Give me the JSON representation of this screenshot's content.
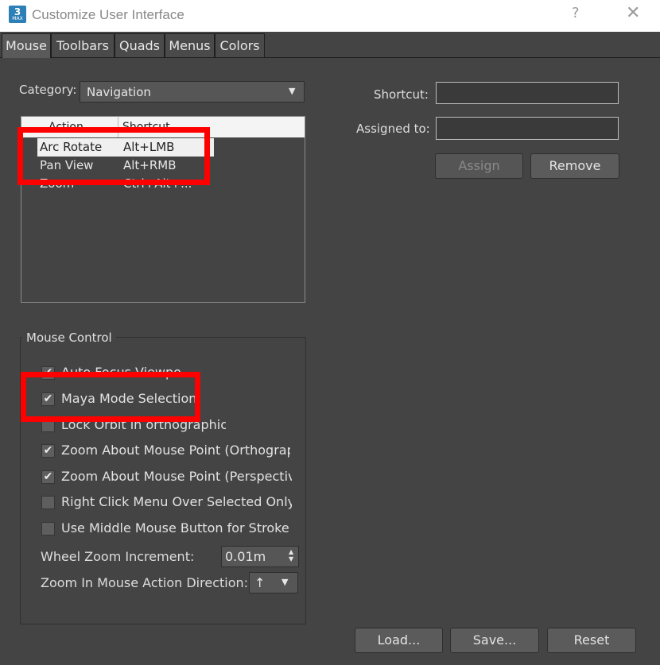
{
  "window": {
    "title": "Customize User Interface",
    "icon_number": "3",
    "icon_sub": "MAX",
    "help_glyph": "?",
    "close_glyph": "✕"
  },
  "tabs": [
    {
      "label": "Mouse",
      "active": true
    },
    {
      "label": "Toolbars",
      "active": false
    },
    {
      "label": "Quads",
      "active": false
    },
    {
      "label": "Menus",
      "active": false
    },
    {
      "label": "Colors",
      "active": false
    }
  ],
  "category": {
    "label": "Category:",
    "value": "Navigation"
  },
  "action_list": {
    "headers": [
      "Action",
      "Shortcut"
    ],
    "rows": [
      {
        "action": "Arc Rotate",
        "shortcut": "Alt+LMB",
        "selected": true
      },
      {
        "action": "Pan View",
        "shortcut": "Alt+RMB",
        "selected": false
      },
      {
        "action": "Zoom",
        "shortcut": "Ctrl+Alt+..."
      }
    ]
  },
  "shortcut": {
    "label": "Shortcut:",
    "value": ""
  },
  "assigned_to": {
    "label": "Assigned to:",
    "value": ""
  },
  "buttons": {
    "assign": "Assign",
    "remove": "Remove",
    "load": "Load...",
    "save": "Save...",
    "reset": "Reset"
  },
  "mouse_control": {
    "title": "Mouse Control",
    "options": [
      {
        "label": "Auto Focus Viewport",
        "checked": true
      },
      {
        "label": "Maya Mode Selection",
        "checked": true
      },
      {
        "label": "Lock Orbit in orthographic view",
        "checked": false
      },
      {
        "label": "Zoom About Mouse Point (Orthographic)",
        "checked": true
      },
      {
        "label": "Zoom About Mouse Point (Perspective)",
        "checked": true
      },
      {
        "label": "Right Click Menu Over Selected Only",
        "checked": false
      },
      {
        "label": "Use Middle Mouse Button for Stroke",
        "checked": false
      }
    ],
    "wheel_zoom": {
      "label": "Wheel Zoom Increment:",
      "value": "0.01m"
    },
    "zoom_direction": {
      "label": "Zoom In Mouse Action Direction:",
      "value": "↑"
    }
  },
  "colors": {
    "highlight": "#ff0000",
    "background": "#444444"
  }
}
